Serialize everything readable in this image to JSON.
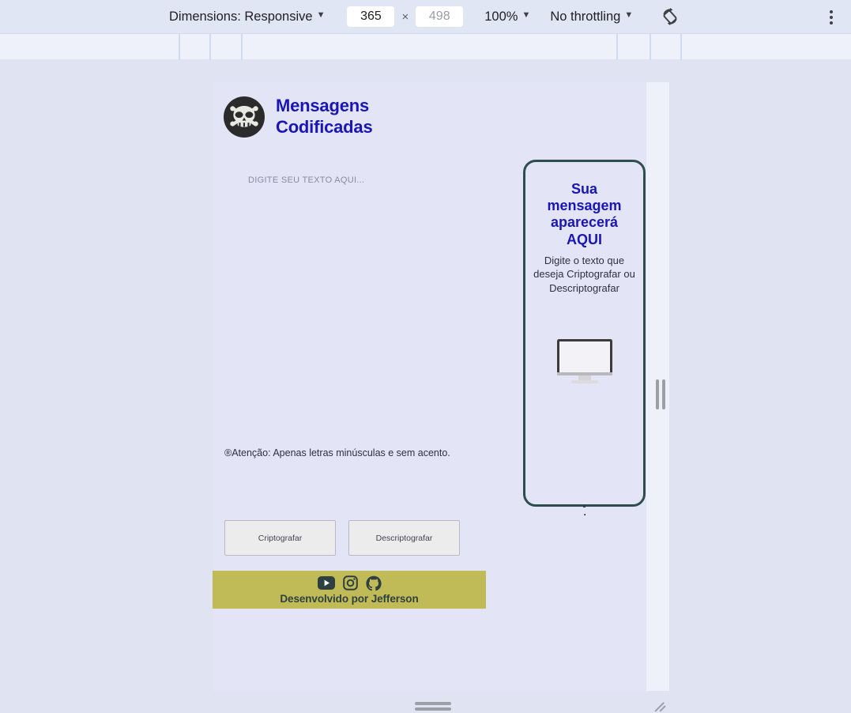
{
  "devtools": {
    "dimensions_label": "Dimensions: Responsive",
    "dimensions_caret": "▼",
    "width_value": "365",
    "height_value": "498",
    "times_symbol": "×",
    "zoom_label": "100%",
    "zoom_caret": "▼",
    "throttling_label": "No throttling",
    "throttling_caret": "▼",
    "rotate_icon": "rotate-device-icon",
    "more_options_icon": "kebab-menu-icon"
  },
  "page": {
    "header": {
      "logo_icon": "skull-crossbones-logo",
      "title": "Mensagens Codificadas"
    },
    "input": {
      "placeholder": "DIGITE SEU TEXTO AQUI...",
      "value": ""
    },
    "notice": "®Atenção: Apenas letras minúsculas e sem acento.",
    "buttons": {
      "encrypt": "Criptografar",
      "decrypt": "Descriptografar"
    },
    "output": {
      "title": "Sua mensagem aparecerá AQUI",
      "subtitle": "Digite o texto que deseja Criptografar ou Descriptografar",
      "illustration_icon": "desktop-monitor-icon",
      "artifact_text": "."
    },
    "footer": {
      "social": [
        {
          "name": "youtube-icon",
          "label": "YouTube"
        },
        {
          "name": "instagram-icon",
          "label": "Instagram"
        },
        {
          "name": "github-icon",
          "label": "GitHub"
        }
      ],
      "credit": "Desenvolvido por Jefferson",
      "background_color": "#c1bb57"
    }
  },
  "colors": {
    "page_background": "#e4e4f7",
    "devtools_background": "#dfe3f2",
    "toolbar_background": "#e1e6f4",
    "title_navy": "#1a16b5",
    "panel_border_teal": "#2e4d4d",
    "footer_khaki": "#c1bb57"
  }
}
